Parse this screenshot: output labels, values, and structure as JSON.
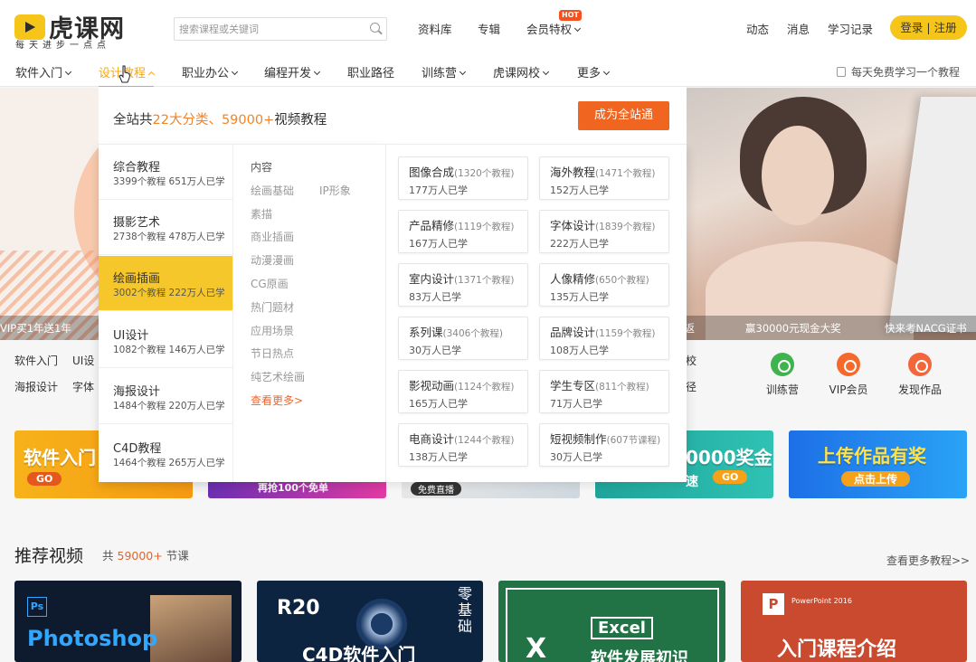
{
  "header": {
    "logo_text": "虎课网",
    "slogan": "每天进步一点点",
    "search_placeholder": "搜索课程或关键词",
    "links": [
      "资料库",
      "专辑",
      "会员特权"
    ],
    "hot_badge": "HOT",
    "right_links": [
      "动态",
      "消息",
      "学习记录"
    ],
    "login_label": "登录 | 注册"
  },
  "nav": {
    "items": [
      "软件入门",
      "设计教程",
      "职业办公",
      "编程开发",
      "职业路径",
      "训练营",
      "虎课网校",
      "更多"
    ],
    "right_text": "每天免费学习一个教程"
  },
  "banner": {
    "strip": [
      "VIP买1年送1年",
      "全返",
      "赢30000元现金大奖",
      "快来考NACG证书"
    ]
  },
  "cats": {
    "row1": [
      "软件入门",
      "UI设",
      "校"
    ],
    "row2": [
      "海报设计",
      "字体",
      "径"
    ]
  },
  "services": [
    {
      "label": "训练营",
      "color": "#3fb34f"
    },
    {
      "label": "VIP会员",
      "color": "#f5692b"
    },
    {
      "label": "发现作品",
      "color": "#f2663a"
    }
  ],
  "promos": {
    "p1_title": "软件入门",
    "p1_go": "GO",
    "p2_text": "再抢100个免单",
    "p3_text": "免费直播",
    "p4_title": "0000奖金",
    "p4_go": "GO",
    "p4_sub": "速",
    "p5_title": "上传作品有奖",
    "p5_sub": "点击上传"
  },
  "recommend": {
    "title": "推荐视频",
    "sub_pre": "共",
    "sub_num": "59000+",
    "sub_post": "节课",
    "more": "查看更多教程>>",
    "cards": [
      {
        "badge": "Ps",
        "text": "Photoshop"
      },
      {
        "badge": "R20",
        "text": "C4D软件入门",
        "vertical": "零基础"
      },
      {
        "badge": "Excel",
        "text": "软件发展初识",
        "letter": "X"
      },
      {
        "badge": "PowerPoint 2016",
        "text": "入门课程介绍",
        "letter": "P"
      }
    ]
  },
  "dropdown": {
    "header_pre": "全站共",
    "header_cats": "22大分类、59000+",
    "header_post": "视频教程",
    "vip_btn": "成为全站通",
    "categories": [
      {
        "name": "综合教程",
        "meta": "3399个教程 651万人已学"
      },
      {
        "name": "摄影艺术",
        "meta": "2738个教程 478万人已学"
      },
      {
        "name": "绘画插画",
        "meta": "3002个教程 222万人已学"
      },
      {
        "name": "UI设计",
        "meta": "1082个教程 146万人已学"
      },
      {
        "name": "海报设计",
        "meta": "1484个教程 220万人已学"
      },
      {
        "name": "C4D教程",
        "meta": "1464个教程 265万人已学"
      }
    ],
    "sub_head": "内容",
    "subs": [
      "绘画基础",
      "IP形象",
      "素描",
      "商业插画",
      "动漫漫画",
      "CG原画",
      "热门题材",
      "应用场景",
      "节日热点",
      "纯艺术绘画"
    ],
    "sub_more": "查看更多>",
    "tiles": [
      {
        "name": "图像合成",
        "count": "(1320个教程)",
        "learners": "177万人已学"
      },
      {
        "name": "海外教程",
        "count": "(1471个教程)",
        "learners": "152万人已学"
      },
      {
        "name": "产品精修",
        "count": "(1119个教程)",
        "learners": "167万人已学"
      },
      {
        "name": "字体设计",
        "count": "(1839个教程)",
        "learners": "222万人已学"
      },
      {
        "name": "室内设计",
        "count": "(1371个教程)",
        "learners": "83万人已学"
      },
      {
        "name": "人像精修",
        "count": "(650个教程)",
        "learners": "135万人已学"
      },
      {
        "name": "系列课",
        "count": "(3406个教程)",
        "learners": "30万人已学"
      },
      {
        "name": "品牌设计",
        "count": "(1159个教程)",
        "learners": "108万人已学"
      },
      {
        "name": "影视动画",
        "count": "(1124个教程)",
        "learners": "165万人已学"
      },
      {
        "name": "学生专区",
        "count": "(811个教程)",
        "learners": "71万人已学"
      },
      {
        "name": "电商设计",
        "count": "(1244个教程)",
        "learners": "138万人已学"
      },
      {
        "name": "短视频制作",
        "count": "(607节课程)",
        "learners": "30万人已学"
      }
    ]
  }
}
